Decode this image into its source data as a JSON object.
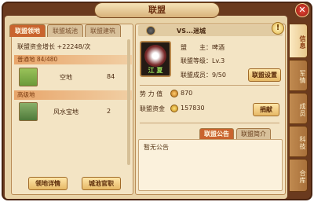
{
  "window": {
    "title": "联盟"
  },
  "left": {
    "tabs": [
      {
        "label": "联盟领地",
        "active": true
      },
      {
        "label": "联盟城池",
        "active": false
      },
      {
        "label": "联盟建筑",
        "active": false
      }
    ],
    "growth": "联盟资金增长 +22248/次",
    "sections": [
      {
        "title": "普通地 84/480",
        "items": [
          {
            "name": "空地",
            "count": "84"
          }
        ]
      },
      {
        "title": "高级地",
        "items": [
          {
            "name": "风水宝地",
            "count": "2"
          }
        ]
      }
    ],
    "buttons": {
      "detail": "领地详情",
      "official": "城池官职"
    }
  },
  "right": {
    "vs_name": "VS...迷城",
    "leader_label": "盟　　主：",
    "leader": "啤酒",
    "level_label": "联盟等级：",
    "level": "Lv.3",
    "members_label": "联盟成员：",
    "members": "9/50",
    "settings_button": "联盟设置",
    "power_label": "势 力 值",
    "power": "870",
    "funds_label": "联盟资金",
    "funds": "157830",
    "donate_button": "捐献",
    "emblem_name": "江 夏",
    "notice_tabs": [
      {
        "label": "联盟公告",
        "active": true
      },
      {
        "label": "联盟简介",
        "active": false
      }
    ],
    "notice_text": "暂无公告"
  },
  "side_tabs": [
    {
      "label": "信息",
      "active": true
    },
    {
      "label": "军情",
      "active": false
    },
    {
      "label": "成员",
      "active": false
    },
    {
      "label": "科技",
      "active": false
    },
    {
      "label": "合库",
      "active": false
    }
  ],
  "colors": {
    "accent": "#c9642e",
    "frame": "#6a3a1e",
    "panel": "#f3e4c4"
  }
}
